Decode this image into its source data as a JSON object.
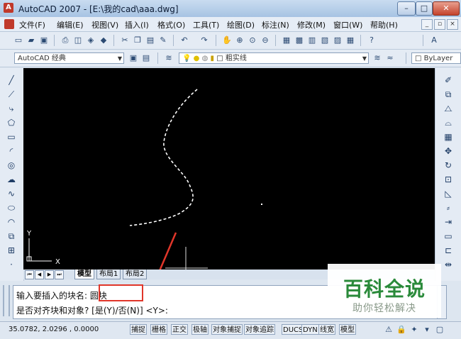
{
  "window": {
    "title": "AutoCAD 2007 - [E:\\我的cad\\aaa.dwg]",
    "buttons": {
      "minimize": "–",
      "restore": "□",
      "close": "✕"
    }
  },
  "menu": {
    "items": [
      "文件(F)",
      "编辑(E)",
      "视图(V)",
      "插入(I)",
      "格式(O)",
      "工具(T)",
      "绘图(D)",
      "标注(N)",
      "修改(M)",
      "窗口(W)",
      "帮助(H)"
    ],
    "mdi": {
      "minimize": "_",
      "restore": "▫",
      "close": "×"
    }
  },
  "toolbar2": {
    "workspace": "AutoCAD 经典",
    "layer": "粗实线",
    "bylayer": "ByLayer"
  },
  "layout_tabs": {
    "tabs": [
      "模型",
      "布局1",
      "布局2"
    ]
  },
  "command": {
    "line1_prompt": "输入要插入的块名",
    "line1_value": ": 圆块",
    "line2": "是否对齐块和对象? [是(Y)/否(N)] <Y>:"
  },
  "status": {
    "coords": "35.0782, 2.0296 , 0.0000",
    "buttons": [
      "捕捉",
      "栅格",
      "正交",
      "极轴",
      "对象捕捉",
      "对象追踪",
      "DUCS",
      "DYN",
      "线宽",
      "模型"
    ]
  },
  "canvas": {
    "ucs_x": "X",
    "ucs_y": "Y"
  },
  "watermark": {
    "main": "百科全说",
    "sub": "助你轻松解决"
  },
  "colors": {
    "canvas_bg": "#000000",
    "highlight": "#e0362a",
    "watermark_green": "#2a8a3a"
  }
}
